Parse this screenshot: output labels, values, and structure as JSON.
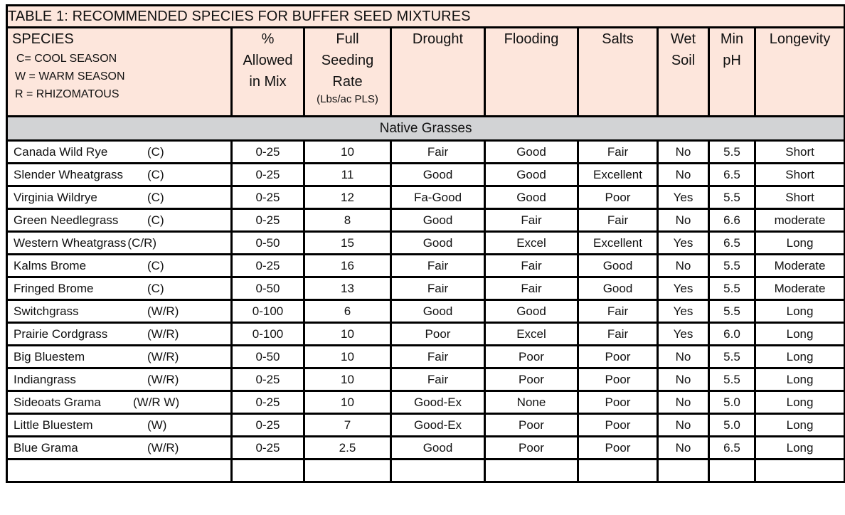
{
  "table": {
    "title": "TABLE 1: RECOMMENDED SPECIES FOR BUFFER SEED MIXTURES",
    "headers": {
      "species": "SPECIES",
      "legend": [
        "C= COOL SEASON",
        "W = WARM SEASON",
        "R = RHIZOMATOUS"
      ],
      "allowed": [
        "%",
        "Allowed",
        "in Mix"
      ],
      "seeding": [
        "Full",
        "Seeding",
        "Rate"
      ],
      "seeding_unit": "(Lbs/ac PLS)",
      "drought": "Drought",
      "flooding": "Flooding",
      "salts": "Salts",
      "wet_soil": [
        "Wet",
        "Soil"
      ],
      "min_ph": [
        "Min",
        "pH"
      ],
      "longevity": "Longevity"
    },
    "section": "Native Grasses",
    "rows": [
      {
        "species": "Canada Wild Rye",
        "season": "(C)",
        "allowed": "0-25",
        "rate": "10",
        "drought": "Fair",
        "flooding": "Good",
        "salts": "Fair",
        "wet_soil": "No",
        "min_ph": "5.5",
        "longevity": "Short"
      },
      {
        "species": "Slender Wheatgrass",
        "season": "(C)",
        "allowed": "0-25",
        "rate": "11",
        "drought": "Good",
        "flooding": "Good",
        "salts": "Excellent",
        "wet_soil": "No",
        "min_ph": "6.5",
        "longevity": "Short"
      },
      {
        "species": "Virginia Wildrye",
        "season": "(C)",
        "allowed": "0-25",
        "rate": "12",
        "drought": "Fa-Good",
        "flooding": "Good",
        "salts": "Poor",
        "wet_soil": "Yes",
        "min_ph": "5.5",
        "longevity": "Short"
      },
      {
        "species": "Green Needlegrass",
        "season": "(C)",
        "allowed": "0-25",
        "rate": "8",
        "drought": "Good",
        "flooding": "Fair",
        "salts": "Fair",
        "wet_soil": "No",
        "min_ph": "6.6",
        "longevity": "moderate"
      },
      {
        "species": "Western Wheatgrass",
        "season": "(C/R)",
        "allowed": "0-50",
        "rate": "15",
        "drought": "Good",
        "flooding": "Excel",
        "salts": "Excellent",
        "wet_soil": "Yes",
        "min_ph": "6.5",
        "longevity": "Long"
      },
      {
        "species": "Kalms Brome",
        "season": "(C)",
        "allowed": "0-25",
        "rate": "16",
        "drought": "Fair",
        "flooding": "Fair",
        "salts": "Good",
        "wet_soil": "No",
        "min_ph": "5.5",
        "longevity": "Moderate"
      },
      {
        "species": "Fringed Brome",
        "season": "(C)",
        "allowed": "0-50",
        "rate": "13",
        "drought": "Fair",
        "flooding": "Fair",
        "salts": "Good",
        "wet_soil": "Yes",
        "min_ph": "5.5",
        "longevity": "Moderate"
      },
      {
        "species": "Switchgrass",
        "season": "(W/R)",
        "allowed": "0-100",
        "rate": "6",
        "drought": "Good",
        "flooding": "Good",
        "salts": "Fair",
        "wet_soil": "Yes",
        "min_ph": "5.5",
        "longevity": "Long"
      },
      {
        "species": "Prairie Cordgrass",
        "season": "(W/R)",
        "allowed": "0-100",
        "rate": "10",
        "drought": "Poor",
        "flooding": "Excel",
        "salts": "Fair",
        "wet_soil": "Yes",
        "min_ph": "6.0",
        "longevity": "Long"
      },
      {
        "species": "Big Bluestem",
        "season": "(W/R)",
        "allowed": "0-50",
        "rate": "10",
        "drought": "Fair",
        "flooding": "Poor",
        "salts": "Poor",
        "wet_soil": "No",
        "min_ph": "5.5",
        "longevity": "Long"
      },
      {
        "species": "Indiangrass",
        "season": "(W/R)",
        "allowed": "0-25",
        "rate": "10",
        "drought": "Fair",
        "flooding": "Poor",
        "salts": "Poor",
        "wet_soil": "No",
        "min_ph": "5.5",
        "longevity": "Long"
      },
      {
        "species": "Sideoats Grama",
        "season": "(W/R  W)",
        "allowed": "0-25",
        "rate": "10",
        "drought": "Good-Ex",
        "flooding": "None",
        "salts": "Poor",
        "wet_soil": "No",
        "min_ph": "5.0",
        "longevity": "Long"
      },
      {
        "species": "Little Bluestem",
        "season": "(W)",
        "allowed": "0-25",
        "rate": "7",
        "drought": "Good-Ex",
        "flooding": "Poor",
        "salts": "Poor",
        "wet_soil": "No",
        "min_ph": "5.0",
        "longevity": "Long"
      },
      {
        "species": "Blue Grama",
        "season": "(W/R)",
        "allowed": "0-25",
        "rate": "2.5",
        "drought": "Good",
        "flooding": "Poor",
        "salts": "Poor",
        "wet_soil": "No",
        "min_ph": "6.5",
        "longevity": "Long"
      }
    ]
  }
}
